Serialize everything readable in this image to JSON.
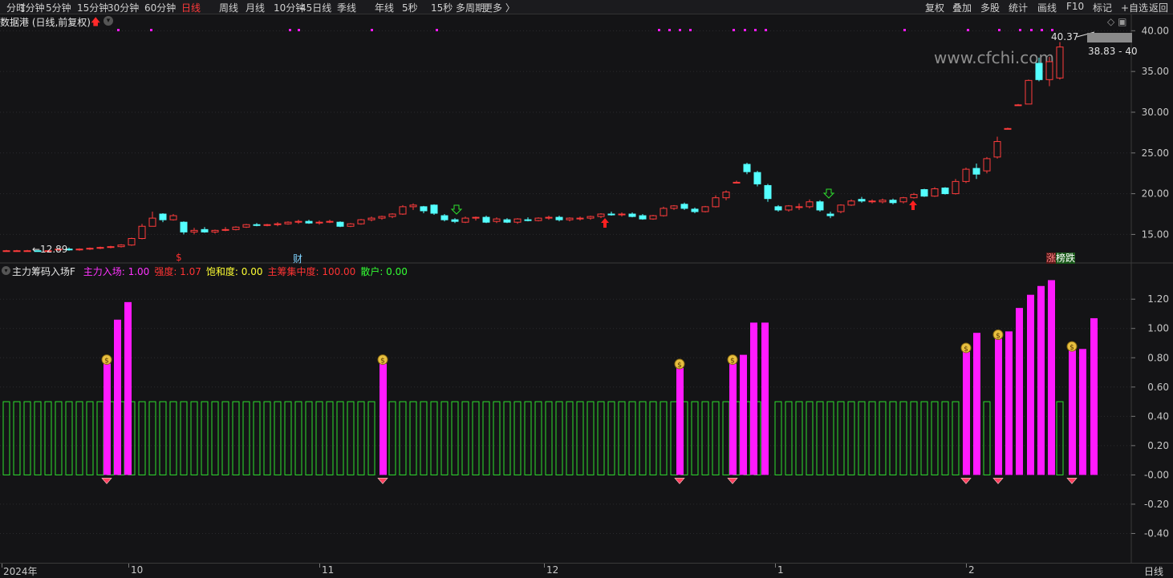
{
  "toolbar": {
    "periods": [
      "分时",
      "1分钟",
      "5分钟",
      "15分钟",
      "30分钟",
      "60分钟",
      "日线",
      "周线",
      "月线",
      "10分钟",
      "45日线",
      "季线",
      "年线",
      "5秒",
      "15秒",
      "多周期",
      "更多 〉"
    ],
    "active_period": "日线",
    "right_buttons": [
      "复权",
      "叠加",
      "多股",
      "统计",
      "画线",
      "F10",
      "标记",
      "+自选",
      "返回"
    ]
  },
  "main_chart": {
    "title": "数据港 (日线,前复权)",
    "watermark": "www.cfchi.com",
    "high_label": "40.37",
    "current_label": "38.83 - 40",
    "low_label": "←12.89",
    "marker_finance": "财",
    "marker_dollar": "$",
    "marker_zdt_left": "涨",
    "marker_zdt_right": "榜跌",
    "y_ticks": [
      "40.00",
      "35.00",
      "30.00",
      "25.00",
      "20.00",
      "15.00"
    ]
  },
  "indicator": {
    "name": "主力筹码入场F",
    "fields": [
      {
        "label": "主力入场:",
        "value": "1.00",
        "color": "#ff33ff"
      },
      {
        "label": "强度:",
        "value": "1.07",
        "color": "#ff3333"
      },
      {
        "label": "饱和度:",
        "value": "0.00",
        "color": "#ffff33"
      },
      {
        "label": "主筹集中度:",
        "value": "100.00",
        "color": "#ff3333"
      },
      {
        "label": "散户:",
        "value": "0.00",
        "color": "#33ff33"
      }
    ],
    "y_ticks": [
      "1.20",
      "1.00",
      "0.80",
      "0.60",
      "0.40",
      "0.20",
      "-0.00",
      "-0.20",
      "-0.40"
    ]
  },
  "date_axis": {
    "labels": [
      "2024年",
      "10",
      "11",
      "12",
      "1",
      "2"
    ],
    "period_label": "日线"
  },
  "colors": {
    "up": "#ff3c3c",
    "down": "#54ffff",
    "magenta": "#ff1aff",
    "green": "#2ee02e",
    "axis_text": "#c8c8c8",
    "grid": "#2a2a2e"
  },
  "chart_data": {
    "type": "candlestick",
    "title": "数据港 (日线,前复权)",
    "ylim": [
      11.5,
      42
    ],
    "ohlc": [
      [
        13.0,
        13.1,
        12.9,
        13.0
      ],
      [
        13.0,
        13.1,
        12.9,
        13.0
      ],
      [
        13.0,
        13.1,
        12.9,
        13.0
      ],
      [
        13.0,
        13.0,
        12.89,
        12.95
      ],
      [
        13.0,
        13.1,
        12.9,
        13.0
      ],
      [
        13.1,
        13.3,
        13.0,
        13.2
      ],
      [
        13.2,
        13.4,
        13.0,
        13.1
      ],
      [
        13.1,
        13.3,
        13.0,
        13.2
      ],
      [
        13.2,
        13.4,
        13.1,
        13.3
      ],
      [
        13.3,
        13.5,
        13.2,
        13.4
      ],
      [
        13.4,
        13.6,
        13.3,
        13.5
      ],
      [
        13.5,
        13.8,
        13.4,
        13.7
      ],
      [
        13.7,
        14.6,
        13.6,
        14.5
      ],
      [
        14.5,
        16.3,
        14.4,
        16.0
      ],
      [
        16.0,
        17.8,
        16.0,
        17.0
      ],
      [
        17.5,
        17.6,
        16.5,
        16.8
      ],
      [
        16.8,
        17.5,
        16.7,
        17.3
      ],
      [
        16.5,
        16.6,
        15.0,
        15.3
      ],
      [
        15.3,
        15.8,
        15.0,
        15.5
      ],
      [
        15.6,
        15.9,
        15.2,
        15.3
      ],
      [
        15.3,
        15.6,
        15.1,
        15.5
      ],
      [
        15.5,
        15.9,
        15.4,
        15.6
      ],
      [
        15.6,
        16.0,
        15.5,
        15.9
      ],
      [
        15.9,
        16.3,
        15.8,
        16.2
      ],
      [
        16.2,
        16.4,
        16.0,
        16.1
      ],
      [
        16.1,
        16.3,
        16.0,
        16.2
      ],
      [
        16.2,
        16.5,
        16.0,
        16.3
      ],
      [
        16.3,
        16.6,
        16.2,
        16.5
      ],
      [
        16.5,
        16.8,
        16.3,
        16.6
      ],
      [
        16.6,
        16.8,
        16.3,
        16.4
      ],
      [
        16.4,
        16.7,
        16.2,
        16.5
      ],
      [
        16.5,
        16.8,
        16.4,
        16.6
      ],
      [
        16.5,
        16.6,
        15.9,
        16.0
      ],
      [
        16.0,
        16.4,
        15.9,
        16.3
      ],
      [
        16.3,
        16.9,
        16.2,
        16.8
      ],
      [
        16.8,
        17.2,
        16.6,
        17.0
      ],
      [
        17.0,
        17.3,
        16.8,
        17.2
      ],
      [
        17.2,
        17.6,
        17.0,
        17.5
      ],
      [
        17.5,
        18.6,
        17.4,
        18.4
      ],
      [
        18.4,
        18.8,
        18.0,
        18.6
      ],
      [
        18.4,
        18.5,
        17.6,
        17.9
      ],
      [
        18.6,
        18.7,
        17.4,
        17.6
      ],
      [
        17.3,
        17.5,
        16.6,
        16.8
      ],
      [
        16.8,
        17.0,
        16.4,
        16.6
      ],
      [
        16.5,
        17.2,
        16.4,
        17.0
      ],
      [
        17.0,
        17.2,
        16.7,
        17.1
      ],
      [
        17.1,
        17.3,
        16.4,
        16.5
      ],
      [
        16.6,
        17.1,
        16.4,
        16.9
      ],
      [
        16.8,
        17.0,
        16.4,
        16.5
      ],
      [
        16.5,
        17.0,
        16.3,
        16.9
      ],
      [
        16.8,
        17.1,
        16.6,
        16.7
      ],
      [
        16.7,
        17.1,
        16.6,
        17.0
      ],
      [
        17.0,
        17.3,
        16.8,
        17.1
      ],
      [
        17.1,
        17.3,
        16.6,
        16.8
      ],
      [
        16.8,
        17.1,
        16.6,
        17.0
      ],
      [
        16.9,
        17.2,
        16.7,
        17.0
      ],
      [
        17.0,
        17.3,
        16.8,
        17.2
      ],
      [
        17.2,
        17.6,
        17.0,
        17.5
      ],
      [
        17.5,
        17.8,
        17.3,
        17.4
      ],
      [
        17.4,
        17.7,
        17.2,
        17.5
      ],
      [
        17.5,
        17.7,
        17.1,
        17.2
      ],
      [
        17.3,
        17.5,
        16.8,
        16.9
      ],
      [
        16.9,
        17.4,
        16.8,
        17.3
      ],
      [
        17.3,
        18.4,
        17.2,
        18.2
      ],
      [
        18.2,
        18.6,
        18.0,
        18.5
      ],
      [
        18.7,
        18.9,
        18.0,
        18.2
      ],
      [
        18.1,
        18.3,
        17.6,
        17.8
      ],
      [
        17.8,
        18.5,
        17.7,
        18.4
      ],
      [
        18.4,
        19.8,
        18.3,
        19.5
      ],
      [
        19.5,
        20.4,
        19.2,
        20.2
      ],
      [
        21.4,
        21.6,
        21.3,
        21.4
      ],
      [
        23.6,
        23.8,
        22.4,
        22.7
      ],
      [
        22.6,
        22.8,
        20.9,
        21.2
      ],
      [
        21.0,
        21.2,
        19.0,
        19.4
      ],
      [
        18.4,
        18.6,
        17.8,
        18.0
      ],
      [
        18.0,
        18.6,
        17.8,
        18.5
      ],
      [
        18.3,
        18.8,
        18.0,
        18.4
      ],
      [
        18.4,
        19.3,
        18.2,
        19.0
      ],
      [
        19.0,
        19.2,
        17.8,
        18.0
      ],
      [
        17.5,
        17.8,
        17.0,
        17.3
      ],
      [
        17.8,
        18.7,
        17.6,
        18.6
      ],
      [
        18.6,
        19.3,
        18.5,
        19.1
      ],
      [
        19.3,
        19.6,
        18.9,
        19.1
      ],
      [
        19.0,
        19.3,
        18.8,
        19.1
      ],
      [
        19.0,
        19.4,
        18.8,
        19.2
      ],
      [
        19.2,
        19.4,
        18.7,
        18.9
      ],
      [
        19.0,
        19.6,
        18.8,
        19.5
      ],
      [
        19.5,
        20.1,
        19.4,
        19.9
      ],
      [
        20.5,
        20.6,
        19.6,
        19.7
      ],
      [
        19.7,
        20.8,
        19.6,
        20.6
      ],
      [
        20.7,
        20.8,
        19.9,
        20.0
      ],
      [
        20.0,
        21.8,
        19.9,
        21.5
      ],
      [
        21.5,
        23.2,
        21.3,
        23.0
      ],
      [
        23.1,
        23.7,
        21.8,
        22.4
      ],
      [
        22.8,
        24.5,
        22.5,
        24.3
      ],
      [
        24.5,
        27.0,
        24.3,
        26.4
      ],
      [
        28.0,
        28.1,
        27.9,
        28.0
      ],
      [
        30.8,
        31.0,
        30.8,
        30.9
      ],
      [
        31.0,
        34.0,
        31.0,
        33.9
      ],
      [
        36.0,
        36.7,
        33.8,
        34.0
      ],
      [
        34.0,
        36.8,
        33.2,
        36.2
      ],
      [
        34.2,
        38.6,
        34.0,
        38.0
      ]
    ],
    "indicator_ylim": [
      -0.6,
      1.42
    ],
    "indicator_bars": [
      {
        "x": 133,
        "h": 0.76,
        "icon": true
      },
      {
        "x": 146,
        "h": 1.06
      },
      {
        "x": 159,
        "h": 1.18
      },
      {
        "x": 477,
        "h": 0.76,
        "icon": true
      },
      {
        "x": 847,
        "h": 0.73,
        "icon": true
      },
      {
        "x": 913,
        "h": 0.76,
        "icon": true
      },
      {
        "x": 926,
        "h": 0.82
      },
      {
        "x": 939,
        "h": 1.04
      },
      {
        "x": 953,
        "h": 1.04
      },
      {
        "x": 1204,
        "h": 0.84,
        "icon": true
      },
      {
        "x": 1217,
        "h": 0.97
      },
      {
        "x": 1244,
        "h": 0.93,
        "icon": true
      },
      {
        "x": 1257,
        "h": 0.98
      },
      {
        "x": 1270,
        "h": 1.14
      },
      {
        "x": 1284,
        "h": 1.23
      },
      {
        "x": 1297,
        "h": 1.29
      },
      {
        "x": 1310,
        "h": 1.33
      },
      {
        "x": 1336,
        "h": 0.85,
        "icon": true
      },
      {
        "x": 1349,
        "h": 0.86
      },
      {
        "x": 1363,
        "h": 1.07
      }
    ],
    "retail_level": 0.5
  }
}
